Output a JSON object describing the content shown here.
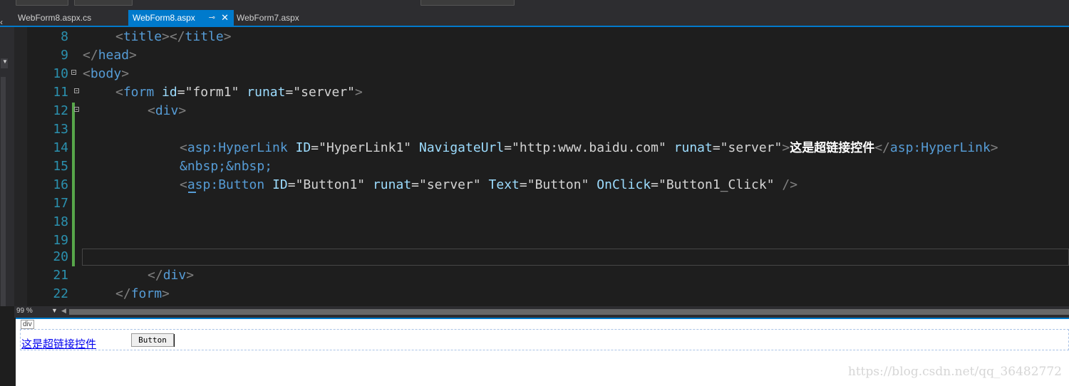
{
  "tabs": [
    {
      "label": "WebForm8.aspx.cs",
      "active": false
    },
    {
      "label": "WebForm8.aspx",
      "active": true,
      "pin": "⊸",
      "close": "✕"
    },
    {
      "label": "WebForm7.aspx",
      "active": false
    }
  ],
  "editor": {
    "lines": [
      {
        "num": "8"
      },
      {
        "num": "9"
      },
      {
        "num": "10"
      },
      {
        "num": "11"
      },
      {
        "num": "12"
      },
      {
        "num": "13"
      },
      {
        "num": "14"
      },
      {
        "num": "15"
      },
      {
        "num": "16"
      },
      {
        "num": "17"
      },
      {
        "num": "18"
      },
      {
        "num": "19"
      },
      {
        "num": "20"
      },
      {
        "num": "21"
      },
      {
        "num": "22"
      }
    ],
    "code": {
      "l8": {
        "open": "<",
        "tag": "title",
        "mid": "></",
        "tag2": "title",
        "close": ">"
      },
      "l9": {
        "open": "</",
        "tag": "head",
        "close": ">"
      },
      "l10": {
        "open": "<",
        "tag": "body",
        "close": ">"
      },
      "l11": {
        "open": "<",
        "tag": "form",
        "a1": "id",
        "v1": "=\"form1\"",
        "a2": "runat",
        "v2": "=\"server\"",
        "close": ">"
      },
      "l12": {
        "open": "<",
        "tag": "div",
        "close": ">"
      },
      "l14": {
        "open": "<",
        "tag": "asp:HyperLink",
        "a1": "ID",
        "v1": "=\"HyperLink1\"",
        "a2": "NavigateUrl",
        "v2": "=\"http:www.baidu.com\"",
        "a3": "runat",
        "v3": "=\"server\"",
        "close": ">",
        "text": "这是超链接控件",
        "endopen": "</",
        "endtag": "asp:HyperLink",
        "endclose": ">"
      },
      "l15": {
        "entities": "&nbsp;&nbsp;"
      },
      "l16": {
        "open": "<",
        "tag": "asp:Button",
        "a1": "ID",
        "v1": "=\"Button1\"",
        "a2": "runat",
        "v2": "=\"server\"",
        "a3": "Text",
        "v3": "=\"Button\"",
        "a4": "OnClick",
        "v4": "=\"Button1_Click\"",
        "close": " />"
      },
      "l21": {
        "open": "</",
        "tag": "div",
        "close": ">"
      },
      "l22": {
        "open": "</",
        "tag": "form",
        "close": ">"
      }
    }
  },
  "zoom": {
    "level": "99 %"
  },
  "design": {
    "div_tag": "div",
    "hyperlink_text": "这是超链接控件",
    "button_text": "Button",
    "watermark": "https://blog.csdn.net/qq_36482772"
  },
  "colors": {
    "accent": "#007acc",
    "tag": "#569cd6",
    "attribute": "#9cdcfe",
    "line_number": "#2b91af",
    "change_bar": "#57a64a"
  }
}
